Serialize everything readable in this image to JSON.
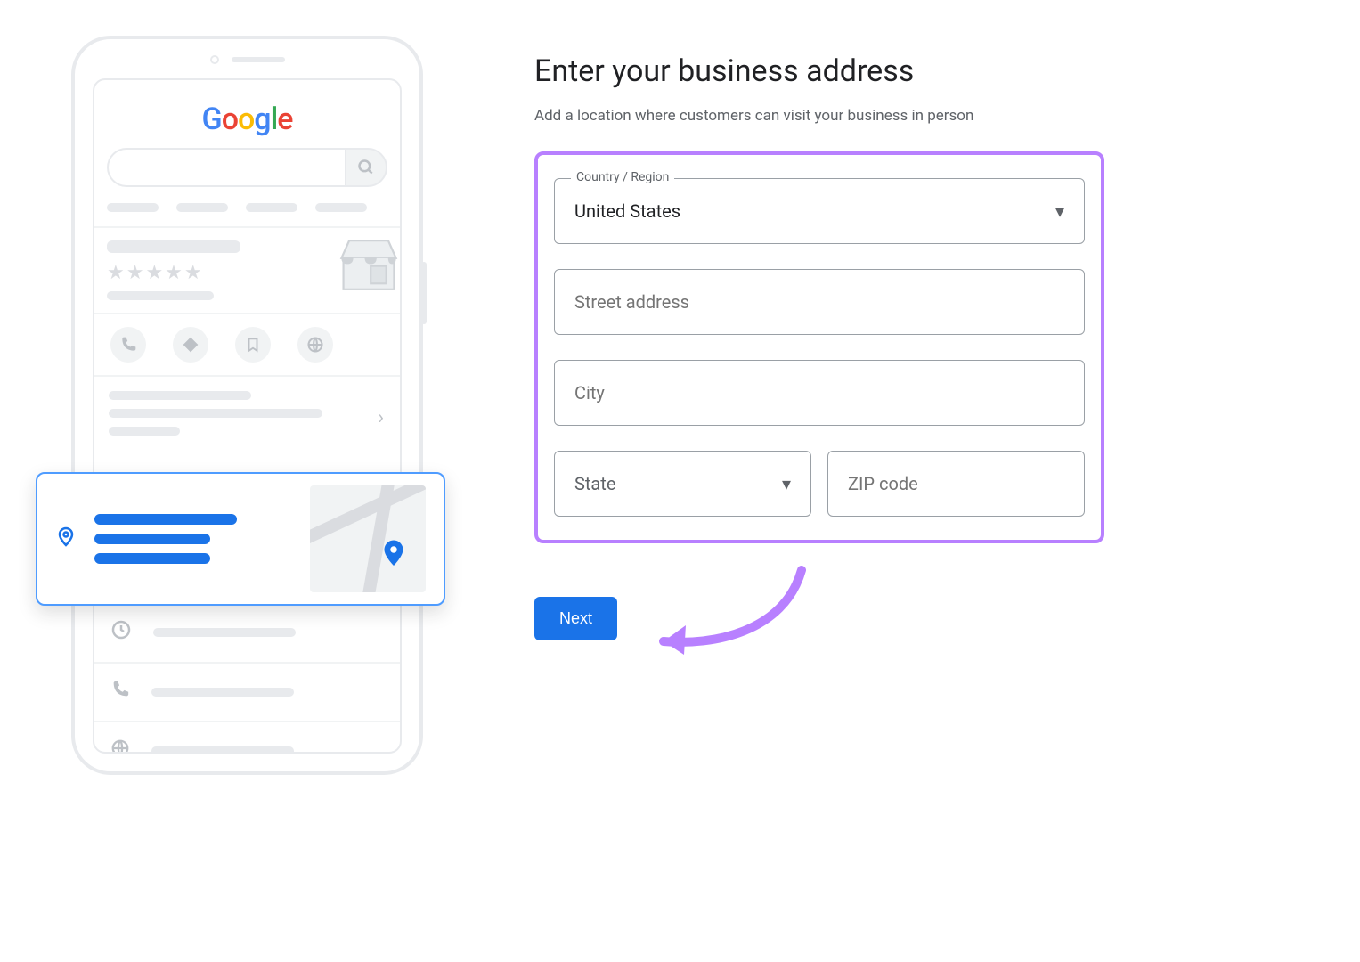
{
  "heading": "Enter your business address",
  "subtitle": "Add a location where customers can visit your business in person",
  "form": {
    "country_label": "Country / Region",
    "country_value": "United States",
    "street_placeholder": "Street address",
    "city_placeholder": "City",
    "state_placeholder": "State",
    "zip_placeholder": "ZIP code"
  },
  "next_label": "Next",
  "illustration": {
    "logo_letters": "Google"
  }
}
